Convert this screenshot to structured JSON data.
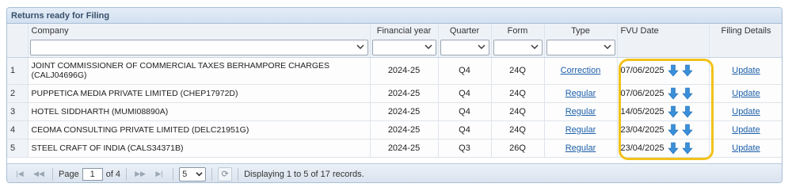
{
  "panel": {
    "title": "Returns ready for Filing"
  },
  "columns": {
    "company": "Company",
    "fy": "Financial year",
    "quarter": "Quarter",
    "form": "Form",
    "type": "Type",
    "fvu": "FVU Date",
    "filing": "Filing Details"
  },
  "rows": [
    {
      "n": "1",
      "company": "JOINT COMMISSIONER OF COMMERCIAL TAXES BERHAMPORE CHARGES (CALJ04696G)",
      "fy": "2024-25",
      "quarter": "Q4",
      "form": "24Q",
      "type": "Correction",
      "fvu": "07/06/2025",
      "filing": "Update"
    },
    {
      "n": "2",
      "company": "PUPPETICA MEDIA PRIVATE LIMITED (CHEP17972D)",
      "fy": "2024-25",
      "quarter": "Q4",
      "form": "24Q",
      "type": "Regular",
      "fvu": "07/06/2025",
      "filing": "Update"
    },
    {
      "n": "3",
      "company": "HOTEL SIDDHARTH (MUMI08890A)",
      "fy": "2024-25",
      "quarter": "Q4",
      "form": "24Q",
      "type": "Regular",
      "fvu": "14/05/2025",
      "filing": "Update"
    },
    {
      "n": "4",
      "company": "CEOMA CONSULTING PRIVATE LIMITED (DELC21951G)",
      "fy": "2024-25",
      "quarter": "Q4",
      "form": "24Q",
      "type": "Regular",
      "fvu": "23/04/2025",
      "filing": "Update"
    },
    {
      "n": "5",
      "company": "STEEL CRAFT OF INDIA (CALS34371B)",
      "fy": "2024-25",
      "quarter": "Q3",
      "form": "26Q",
      "type": "Regular",
      "fvu": "23/04/2025",
      "filing": "Update"
    }
  ],
  "pager": {
    "page_label": "Page",
    "page_value": "1",
    "of_label": "of 4",
    "page_size": "5",
    "status": "Displaying 1 to 5 of 17 records."
  },
  "colors": {
    "accent": "#1c5fa8",
    "highlight": "#f2c21b",
    "arrow": "#3a8fd9"
  }
}
